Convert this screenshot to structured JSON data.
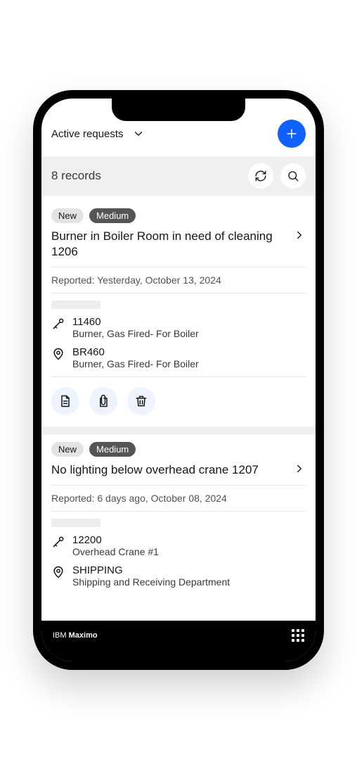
{
  "header": {
    "title": "Active requests"
  },
  "subheader": {
    "records_label": "8 records"
  },
  "requests": [
    {
      "badges": {
        "status": "New",
        "priority": "Medium"
      },
      "title": "Burner in Boiler Room in need of cleaning 1206",
      "reported": "Reported: Yesterday, October 13, 2024",
      "asset": {
        "id": "11460",
        "desc": "Burner, Gas Fired- For Boiler"
      },
      "location": {
        "id": "BR460",
        "desc": "Burner, Gas Fired- For Boiler"
      }
    },
    {
      "badges": {
        "status": "New",
        "priority": "Medium"
      },
      "title": "No lighting below overhead crane 1207",
      "reported": "Reported: 6 days ago, October 08, 2024",
      "asset": {
        "id": "12200",
        "desc": "Overhead Crane #1"
      },
      "location": {
        "id": "SHIPPING",
        "desc": "Shipping and Receiving Department"
      }
    }
  ],
  "footer": {
    "brand1": "IBM ",
    "brand2": "Maximo"
  }
}
